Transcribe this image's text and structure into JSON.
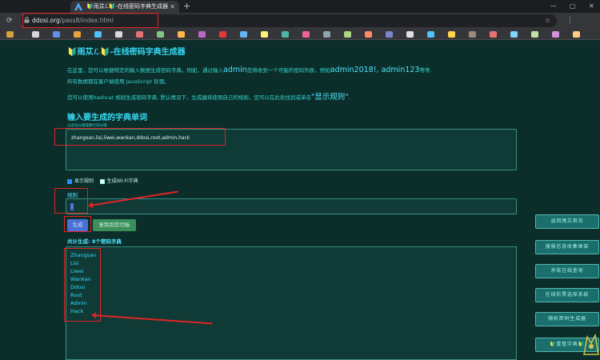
{
  "browser": {
    "tab_title": "🔰雨苁ℒ🔰-在线密码字典生成器",
    "url_host": "ddosi.org",
    "url_path": "/pass8/index.html"
  },
  "page": {
    "title": "🔰雨苁ℒ🔰-在线密码字典生成器",
    "intro_line1_a": "在这里，您可以根据特定的输入数据生成密码字典。例如，通过输入",
    "intro_line1_big1": "admin",
    "intro_line1_b": "您将收到一个可能的密码列表，例如",
    "intro_line1_big2": "admin2018!, admin123",
    "intro_line1_c": "等等.",
    "intro_line2": "所有数据都在客户端使用 JavaScript 处理。",
    "intro_line3_a": "您可以使用hashcat 规则生成密码字典. 默认情况下，生成器将使用自己的规则，您可以在此处找到或单击",
    "intro_line3_big": "\"显示规则\"",
    "intro_line3_b": ".",
    "section_title": "输入要生成的字典单词",
    "hint": "以逗号分隔或换行符分隔",
    "words_value": "zhangsan,lisi,liwei,wankan,ddosi,root,admin,hack",
    "show_rules_label": "显示规则",
    "wifi_label": "生成WI-FI字典",
    "rules_label": "规则",
    "rule_value": ":",
    "generate_label": "生成",
    "copy_label": "复制到剪切板",
    "count_text": "共计生成: 8个密码字典",
    "results": [
      "Zhangsan",
      "Lisi",
      "Liwei",
      "Wankan",
      "Ddosi",
      "Root",
      "Admin",
      "Hack"
    ]
  },
  "sidebar": {
    "buttons": [
      "返回雨苁首页",
      "搜报信息收集框架",
      "杀软在线查询",
      "在线彩票选择系统",
      "随机密码生成器",
      "🔰重整字典🔰"
    ]
  },
  "colors": {
    "annotation_red": "#e02424",
    "accent_cyan": "#38d9f5",
    "page_bg": "#0b2e2a"
  }
}
